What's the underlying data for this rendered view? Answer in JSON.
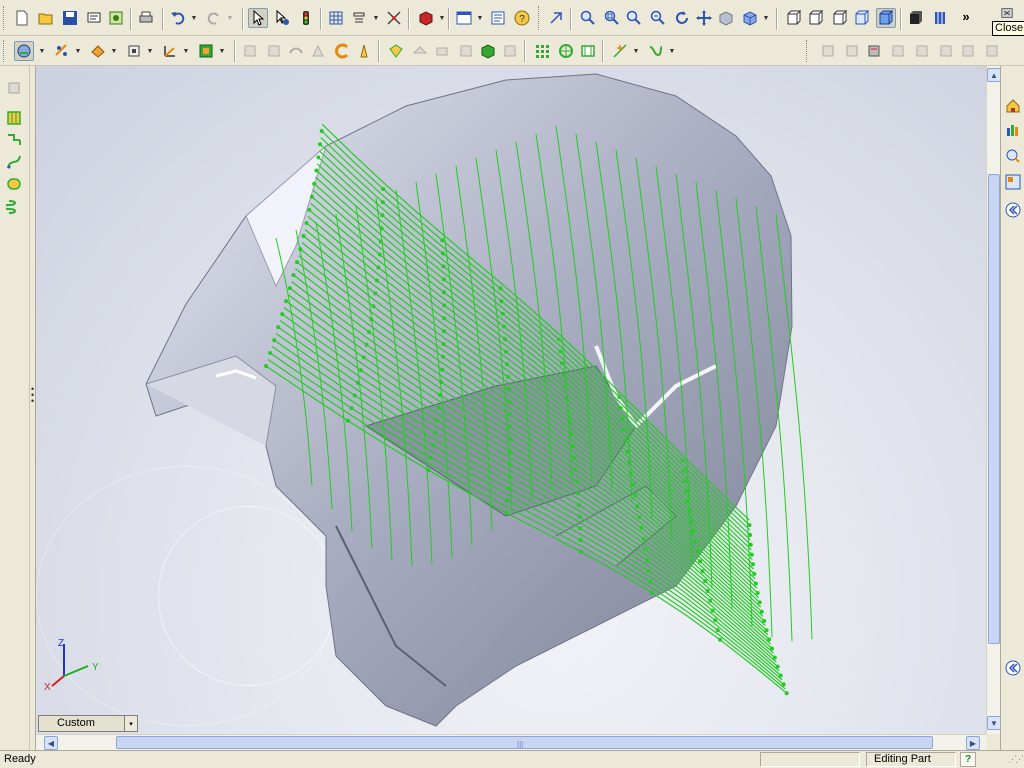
{
  "toolbar_top": {
    "close_tooltip": "Close",
    "overflow_label": "»"
  },
  "toolbar_row1_icons": [
    "new",
    "open",
    "save",
    "print-preview",
    "publish",
    "print",
    "undo",
    "redo",
    "select",
    "select-other",
    "traffic-light",
    "grid",
    "smart-dimension",
    "trim",
    "materials",
    "layout",
    "help",
    "zoom-to-fit",
    "zoom-window",
    "zoom-area",
    "zoom-prev",
    "zoom-out",
    "rotate",
    "pan",
    "section",
    "view-orientation",
    "front-view",
    "back-view",
    "right-view",
    "top-view",
    "isometric-view",
    "shaded",
    "hidden-lines"
  ],
  "toolbar_row2_icons": [
    "display-style",
    "hide-show",
    "edit-appearance",
    "apply-scene",
    "view-settings",
    "section-view",
    "surface-extrude",
    "surface-revolve",
    "surface-sweep",
    "surface-loft",
    "boundary",
    "fill",
    "knit",
    "offset",
    "thicken",
    "trim",
    "untrim",
    "delete-face",
    "planar",
    "split-line",
    "composite-curve",
    "helix",
    "3d-sketch",
    "spline",
    "mold-tools-1",
    "mold-tools-2",
    "mold-tools-3",
    "mold-tools-4",
    "mold-tools-5"
  ],
  "left_panel_icons": [
    "collapse",
    "feature-tree",
    "curve",
    "projected-curve",
    "rebuild",
    "helix"
  ],
  "task_pane_icons": [
    "solidworks-resources",
    "design-library",
    "file-explorer",
    "search",
    "view-palette",
    "expand-panel",
    "collapse-panel"
  ],
  "view_combo": {
    "label": "Custom",
    "arrow": "▾"
  },
  "triad": {
    "x_label": "X",
    "y_label": "Y",
    "z_label": "Z"
  },
  "scroll": {
    "up": "▲",
    "down": "▼",
    "left": "◀",
    "right": "▶",
    "grip": "|||"
  },
  "statusbar": {
    "text": "Ready",
    "mode": "Editing Part",
    "help": "?"
  },
  "colors": {
    "toolbar_bg": "#ece9d8",
    "wireframe": "#22cc22",
    "model_fill": "#b9bccb",
    "viewport_bg": "#dfe2ea"
  }
}
